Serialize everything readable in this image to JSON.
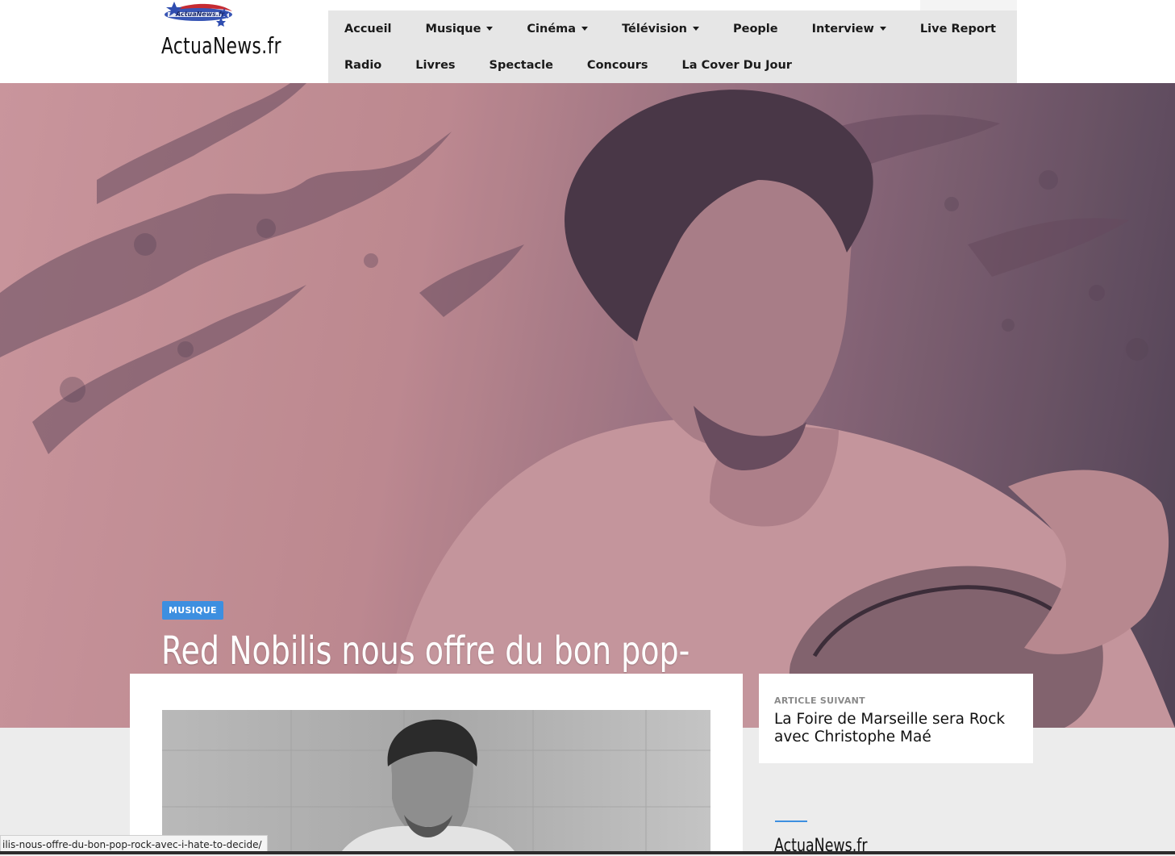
{
  "site": {
    "name": "ActuaNews.fr",
    "logo_badge_text": "ActuaNews.fr"
  },
  "nav": {
    "items": [
      {
        "label": "Accueil",
        "dropdown": false
      },
      {
        "label": "Musique",
        "dropdown": true
      },
      {
        "label": "Cinéma",
        "dropdown": true
      },
      {
        "label": "Télévision",
        "dropdown": true
      },
      {
        "label": "People",
        "dropdown": false
      },
      {
        "label": "Interview",
        "dropdown": true
      },
      {
        "label": "Live Report",
        "dropdown": false
      },
      {
        "label": "Radio",
        "dropdown": false
      },
      {
        "label": "Livres",
        "dropdown": false
      },
      {
        "label": "Spectacle",
        "dropdown": false
      },
      {
        "label": "Concours",
        "dropdown": false
      },
      {
        "label": "La Cover Du Jour",
        "dropdown": false
      }
    ]
  },
  "hero": {
    "category": "MUSIQUE",
    "title": "Red Nobilis nous offre du bon pop-rock avec I Hate To Decide"
  },
  "next_article": {
    "label": "ARTICLE SUIVANT",
    "title": "La Foire de Marseille sera Rock avec Christophe Maé"
  },
  "sidebar": {
    "title": "ActuaNews.fr"
  },
  "status_bar": {
    "url": "ilis-nous-offre-du-bon-pop-rock-avec-i-hate-to-decide/"
  },
  "colors": {
    "accent": "#3d8fe0",
    "nav_bg": "#e6e6e6",
    "hero_tint": "#d7a0a6"
  }
}
